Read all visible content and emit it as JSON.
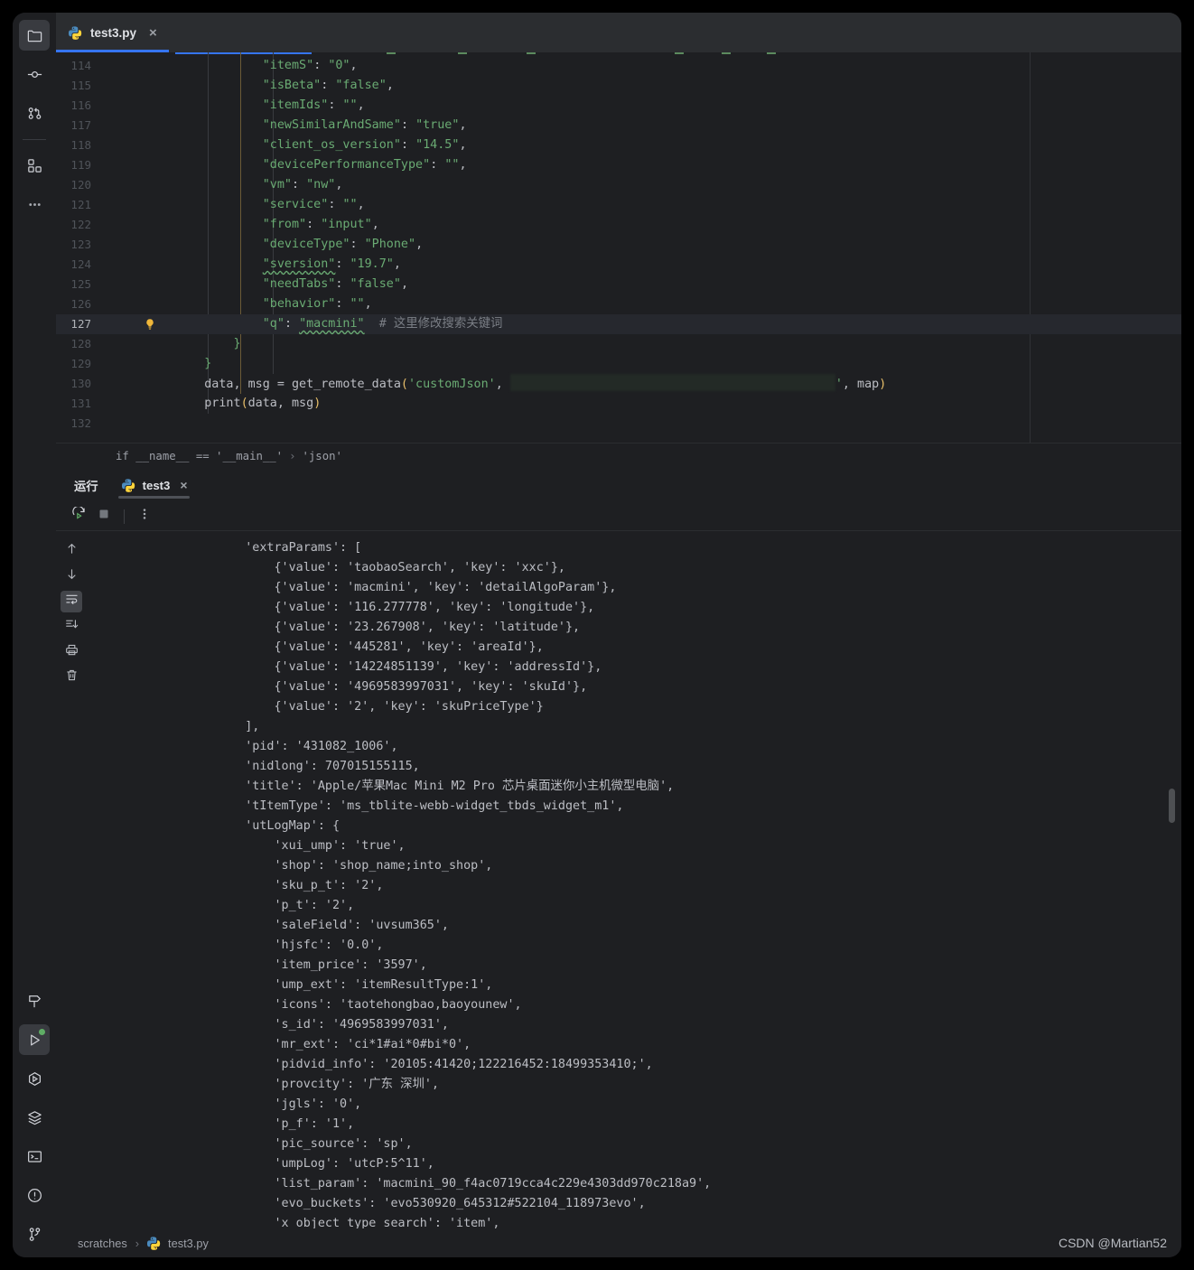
{
  "window": {
    "background": "#1e1f22",
    "accent": "#3574f0"
  },
  "activity_bar": {
    "top_items": [
      {
        "name": "project-folder",
        "icon": "folder-icon",
        "selected": true
      },
      {
        "name": "commit",
        "icon": "commit-icon",
        "selected": false
      },
      {
        "name": "pull-requests",
        "icon": "pull-request-icon",
        "selected": false
      },
      {
        "name": "plugins",
        "icon": "plugins-icon",
        "selected": false
      },
      {
        "name": "more-tool-windows",
        "icon": "ellipsis-icon",
        "selected": false
      }
    ],
    "bottom_items": [
      {
        "name": "build",
        "icon": "hammer-icon",
        "selected": false
      },
      {
        "name": "run",
        "icon": "play-icon",
        "selected": true,
        "badge": true
      },
      {
        "name": "debug",
        "icon": "debug-icon",
        "selected": false
      },
      {
        "name": "services",
        "icon": "layers-icon",
        "selected": false
      },
      {
        "name": "terminal",
        "icon": "terminal-icon",
        "selected": false
      },
      {
        "name": "problems",
        "icon": "warning-circle-icon",
        "selected": false
      },
      {
        "name": "version-control",
        "icon": "branch-icon",
        "selected": false
      }
    ]
  },
  "tabbar": {
    "tabs": [
      {
        "label": "test3.py",
        "icon": "python-file-icon",
        "active": true,
        "close": "×"
      }
    ]
  },
  "editor": {
    "first_visible_line": 114,
    "highlighted_line": 127,
    "lines": [
      {
        "n": 114,
        "segments": [
          {
            "t": "            ",
            "c": "txt"
          },
          {
            "t": "\"itemS\"",
            "c": "str"
          },
          {
            "t": ": ",
            "c": "txt"
          },
          {
            "t": "\"0\"",
            "c": "str"
          },
          {
            "t": ",",
            "c": "txt"
          }
        ]
      },
      {
        "n": 115,
        "segments": [
          {
            "t": "            ",
            "c": "txt"
          },
          {
            "t": "\"isBeta\"",
            "c": "str"
          },
          {
            "t": ": ",
            "c": "txt"
          },
          {
            "t": "\"false\"",
            "c": "str"
          },
          {
            "t": ",",
            "c": "txt"
          }
        ]
      },
      {
        "n": 116,
        "segments": [
          {
            "t": "            ",
            "c": "txt"
          },
          {
            "t": "\"itemIds\"",
            "c": "str"
          },
          {
            "t": ": ",
            "c": "txt"
          },
          {
            "t": "\"\"",
            "c": "str"
          },
          {
            "t": ",",
            "c": "txt"
          }
        ]
      },
      {
        "n": 117,
        "segments": [
          {
            "t": "            ",
            "c": "txt"
          },
          {
            "t": "\"newSimilarAndSame\"",
            "c": "str"
          },
          {
            "t": ": ",
            "c": "txt"
          },
          {
            "t": "\"true\"",
            "c": "str"
          },
          {
            "t": ",",
            "c": "txt"
          }
        ]
      },
      {
        "n": 118,
        "segments": [
          {
            "t": "            ",
            "c": "txt"
          },
          {
            "t": "\"client_os_version\"",
            "c": "str"
          },
          {
            "t": ": ",
            "c": "txt"
          },
          {
            "t": "\"14.5\"",
            "c": "str"
          },
          {
            "t": ",",
            "c": "txt"
          }
        ]
      },
      {
        "n": 119,
        "segments": [
          {
            "t": "            ",
            "c": "txt"
          },
          {
            "t": "\"devicePerformanceType\"",
            "c": "str"
          },
          {
            "t": ": ",
            "c": "txt"
          },
          {
            "t": "\"\"",
            "c": "str"
          },
          {
            "t": ",",
            "c": "txt"
          }
        ]
      },
      {
        "n": 120,
        "segments": [
          {
            "t": "            ",
            "c": "txt"
          },
          {
            "t": "\"vm\"",
            "c": "str"
          },
          {
            "t": ": ",
            "c": "txt"
          },
          {
            "t": "\"nw\"",
            "c": "str"
          },
          {
            "t": ",",
            "c": "txt"
          }
        ]
      },
      {
        "n": 121,
        "segments": [
          {
            "t": "            ",
            "c": "txt"
          },
          {
            "t": "\"service\"",
            "c": "str"
          },
          {
            "t": ": ",
            "c": "txt"
          },
          {
            "t": "\"\"",
            "c": "str"
          },
          {
            "t": ",",
            "c": "txt"
          }
        ]
      },
      {
        "n": 122,
        "segments": [
          {
            "t": "            ",
            "c": "txt"
          },
          {
            "t": "\"from\"",
            "c": "str"
          },
          {
            "t": ": ",
            "c": "txt"
          },
          {
            "t": "\"input\"",
            "c": "str"
          },
          {
            "t": ",",
            "c": "txt"
          }
        ]
      },
      {
        "n": 123,
        "segments": [
          {
            "t": "            ",
            "c": "txt"
          },
          {
            "t": "\"deviceType\"",
            "c": "str"
          },
          {
            "t": ": ",
            "c": "txt"
          },
          {
            "t": "\"Phone\"",
            "c": "str"
          },
          {
            "t": ",",
            "c": "txt"
          }
        ]
      },
      {
        "n": 124,
        "segments": [
          {
            "t": "            ",
            "c": "txt"
          },
          {
            "t": "\"sversion\"",
            "c": "str-squiggle"
          },
          {
            "t": ": ",
            "c": "txt"
          },
          {
            "t": "\"19.7\"",
            "c": "str"
          },
          {
            "t": ",",
            "c": "txt"
          }
        ]
      },
      {
        "n": 125,
        "segments": [
          {
            "t": "            ",
            "c": "txt"
          },
          {
            "t": "\"needTabs\"",
            "c": "str"
          },
          {
            "t": ": ",
            "c": "txt"
          },
          {
            "t": "\"false\"",
            "c": "str"
          },
          {
            "t": ",",
            "c": "txt"
          }
        ]
      },
      {
        "n": 126,
        "segments": [
          {
            "t": "            ",
            "c": "txt"
          },
          {
            "t": "\"behavior\"",
            "c": "str"
          },
          {
            "t": ": ",
            "c": "txt"
          },
          {
            "t": "\"\"",
            "c": "str"
          },
          {
            "t": ",",
            "c": "txt"
          }
        ]
      },
      {
        "n": 127,
        "segments": [
          {
            "t": "            ",
            "c": "txt"
          },
          {
            "t": "\"q\"",
            "c": "str"
          },
          {
            "t": ": ",
            "c": "txt"
          },
          {
            "t": "\"macmini\"",
            "c": "str-squiggle"
          },
          {
            "t": "  ",
            "c": "txt"
          },
          {
            "t": "# 这里修改搜索关键词",
            "c": "cmt"
          }
        ],
        "bulb": true
      },
      {
        "n": 128,
        "segments": [
          {
            "t": "        ",
            "c": "txt"
          },
          {
            "t": "}",
            "c": "str"
          }
        ]
      },
      {
        "n": 129,
        "segments": [
          {
            "t": "    ",
            "c": "txt"
          },
          {
            "t": "}",
            "c": "str"
          }
        ]
      },
      {
        "n": 130,
        "segments": [
          {
            "t": "    ",
            "c": "txt"
          },
          {
            "t": "data, msg = get_remote_data",
            "c": "txt"
          },
          {
            "t": "(",
            "c": "paren"
          },
          {
            "t": "'customJson'",
            "c": "str"
          },
          {
            "t": ", ",
            "c": "txt"
          },
          {
            "t": "",
            "c": "redact"
          },
          {
            "t": "'",
            "c": "str"
          },
          {
            "t": ", map",
            "c": "txt"
          },
          {
            "t": ")",
            "c": "paren"
          }
        ]
      },
      {
        "n": 131,
        "segments": [
          {
            "t": "    ",
            "c": "txt"
          },
          {
            "t": "print",
            "c": "txt"
          },
          {
            "t": "(",
            "c": "paren"
          },
          {
            "t": "data, msg",
            "c": "txt"
          },
          {
            "t": ")",
            "c": "paren"
          }
        ]
      },
      {
        "n": 132,
        "segments": []
      }
    ],
    "breadcrumb": {
      "scope": "if __name__ == '__main__'",
      "separator": "›",
      "member": "'json'"
    }
  },
  "run_panel": {
    "title": "运行",
    "tab": {
      "label": "test3",
      "icon": "python-file-icon",
      "close": "×",
      "active": true
    },
    "toolbar": [
      {
        "name": "rerun-button",
        "icon": "rerun-icon"
      },
      {
        "name": "stop-button",
        "icon": "stop-icon"
      },
      {
        "name": "more-options-button",
        "icon": "vertical-ellipsis-icon"
      }
    ],
    "console_sidebar": [
      {
        "name": "scroll-up-button",
        "icon": "arrow-up-icon",
        "selected": false
      },
      {
        "name": "scroll-down-button",
        "icon": "arrow-down-icon",
        "selected": false
      },
      {
        "name": "soft-wrap-button",
        "icon": "soft-wrap-icon",
        "selected": true
      },
      {
        "name": "scroll-to-end-button",
        "icon": "scroll-to-end-icon",
        "selected": false
      },
      {
        "name": "print-button",
        "icon": "printer-icon",
        "selected": false
      },
      {
        "name": "clear-all-button",
        "icon": "trash-icon",
        "selected": false
      }
    ],
    "output_lines": [
      "                    'extraParams': [",
      "                        {'value': 'taobaoSearch', 'key': 'xxc'},",
      "                        {'value': 'macmini', 'key': 'detailAlgoParam'},",
      "                        {'value': '116.277778', 'key': 'longitude'},",
      "                        {'value': '23.267908', 'key': 'latitude'},",
      "                        {'value': '445281', 'key': 'areaId'},",
      "                        {'value': '14224851139', 'key': 'addressId'},",
      "                        {'value': '4969583997031', 'key': 'skuId'},",
      "                        {'value': '2', 'key': 'skuPriceType'}",
      "                    ],",
      "                    'pid': '431082_1006',",
      "                    'nidlong': 707015155115,",
      "                    'title': 'Apple/苹果Mac Mini M2 Pro 芯片桌面迷你小主机微型电脑',",
      "                    'tItemType': 'ms_tblite-webb-widget_tbds_widget_m1',",
      "                    'utLogMap': {",
      "                        'xui_ump': 'true',",
      "                        'shop': 'shop_name;into_shop',",
      "                        'sku_p_t': '2',",
      "                        'p_t': '2',",
      "                        'saleField': 'uvsum365',",
      "                        'hjsfc': '0.0',",
      "                        'item_price': '3597',",
      "                        'ump_ext': 'itemResultType:1',",
      "                        'icons': 'taotehongbao,baoyounew',",
      "                        's_id': '4969583997031',",
      "                        'mr_ext': 'ci*1#ai*0#bi*0',",
      "                        'pidvid_info': '20105:41420;122216452:18499353410;',",
      "                        'provcity': '广东 深圳',",
      "                        'jgls': '0',",
      "                        'p_f': '1',",
      "                        'pic_source': 'sp',",
      "                        'umpLog': 'utcP:5^11',",
      "                        'list_param': 'macmini_90_f4ac0719cca4c229e4303dd970c218a9',",
      "                        'evo_buckets': 'evo530920_645312#522104_118973evo',",
      "                        'x_object_type_search': 'item',"
    ]
  },
  "statusbar": {
    "breadcrumb_root": "scratches",
    "separator": "›",
    "breadcrumb_file": "test3.py",
    "file_icon": "python-file-icon",
    "watermark": "CSDN @Martian52"
  }
}
